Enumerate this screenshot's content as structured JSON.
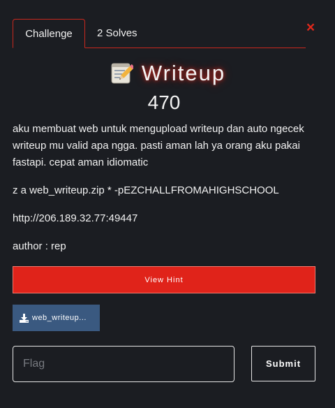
{
  "tabs": [
    {
      "label": "Challenge",
      "active": true
    },
    {
      "label": "2 Solves",
      "active": false
    }
  ],
  "close": {
    "symbol": "×",
    "color": "#e0281c"
  },
  "challenge": {
    "icon": "memo-icon",
    "name": "Writeup",
    "points": "470",
    "description": [
      "aku membuat web untuk mengupload writeup dan auto ngecek writeup mu valid apa ngga. pasti aman lah ya orang aku pakai fastapi. cepat aman idiomatic",
      "z a web_writeup.zip * -pEZCHALLFROMAHIGHSCHOOL",
      "http://206.189.32.77:49447",
      "author : rep"
    ]
  },
  "hint": {
    "label": "View Hint"
  },
  "file": {
    "icon": "download-icon",
    "label": "web_writeup..."
  },
  "flag_form": {
    "placeholder": "Flag",
    "value": "",
    "submit_label": "Submit"
  },
  "colors": {
    "background": "#1b1d22",
    "accent": "#e0231a",
    "file_button": "#3a5980"
  }
}
